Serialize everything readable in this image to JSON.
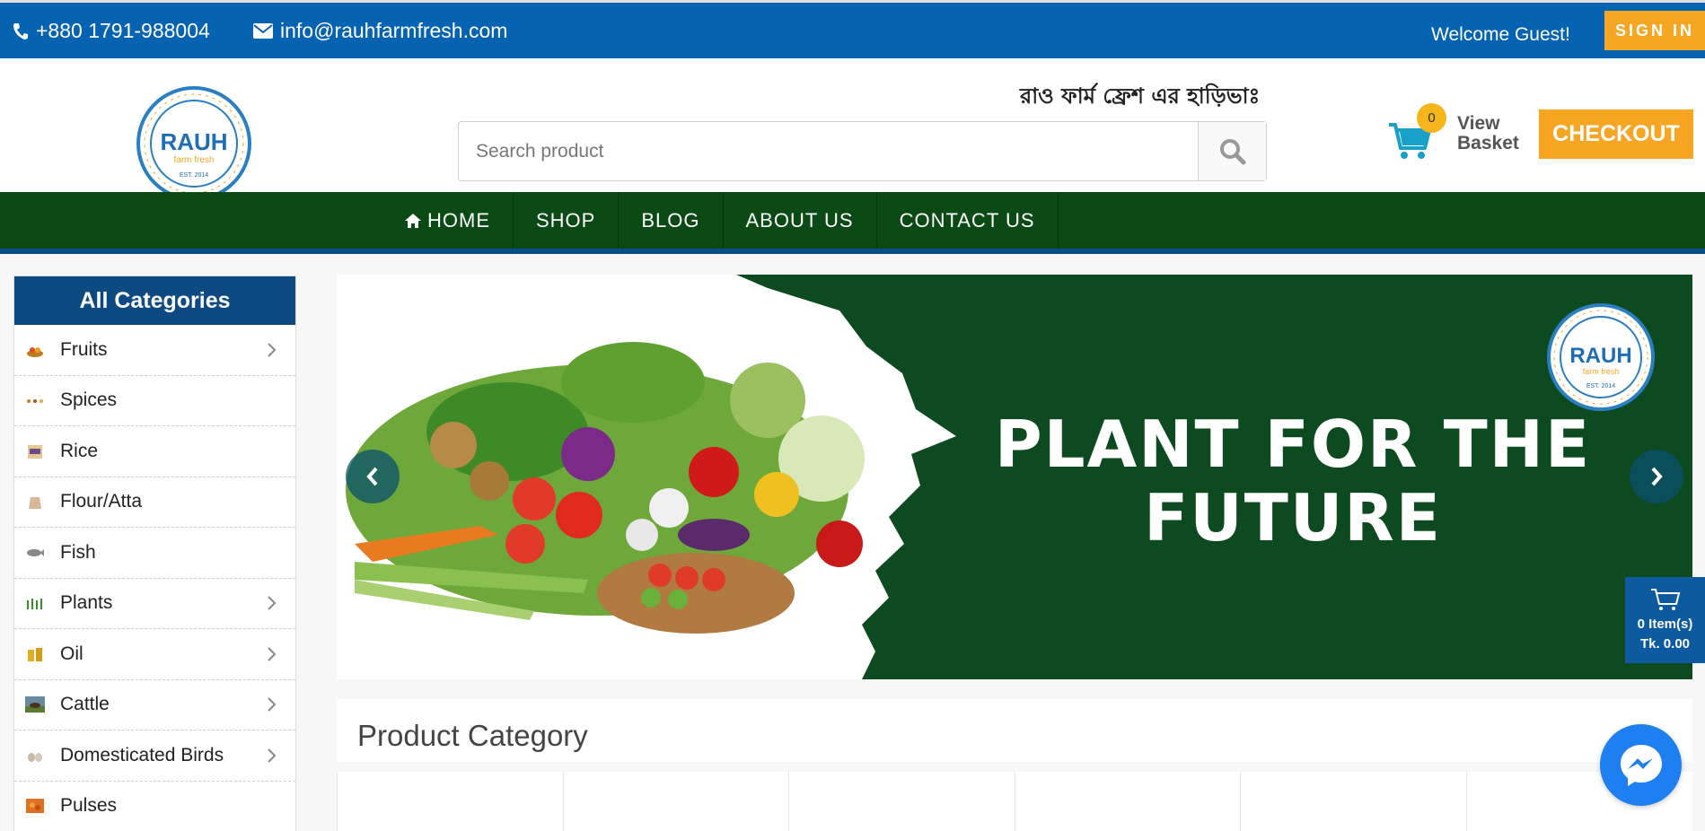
{
  "topbar": {
    "phone": "+880 1791-988004",
    "email": "info@rauhfarmfresh.com",
    "welcome": "Welcome Guest!",
    "signin_label": "SIGN IN"
  },
  "header": {
    "logo_text": "RAUH",
    "tagline": "রাও ফার্ম ফ্রেশ এর হাড়িভাঃ",
    "search_placeholder": "Search product",
    "cart_count": "0",
    "view_basket_line1": "View",
    "view_basket_line2": "Basket",
    "checkout_label": "CHECKOUT"
  },
  "nav": {
    "items": [
      "HOME",
      "SHOP",
      "BLOG",
      "ABOUT US",
      "CONTACT US"
    ]
  },
  "sidebar": {
    "title": "All Categories",
    "items": [
      {
        "label": "Fruits",
        "has_sub": true
      },
      {
        "label": "Spices",
        "has_sub": false
      },
      {
        "label": "Rice",
        "has_sub": false
      },
      {
        "label": "Flour/Atta",
        "has_sub": false
      },
      {
        "label": "Fish",
        "has_sub": false
      },
      {
        "label": "Plants",
        "has_sub": true
      },
      {
        "label": "Oil",
        "has_sub": true
      },
      {
        "label": "Cattle",
        "has_sub": true
      },
      {
        "label": "Domesticated Birds",
        "has_sub": true
      },
      {
        "label": "Pulses",
        "has_sub": false
      }
    ]
  },
  "banner": {
    "line1": "PLANT FOR THE",
    "line2": "FUTURE",
    "logo_text": "RAUH"
  },
  "mini_cart": {
    "items": "0 Item(s)",
    "total": "Tk. 0.00"
  },
  "product_category": {
    "title": "Product Category"
  },
  "colors": {
    "topbar": "#0563b1",
    "nav": "#0b4a15",
    "accent": "#f6a623",
    "banner_green": "#0d4a1f"
  }
}
